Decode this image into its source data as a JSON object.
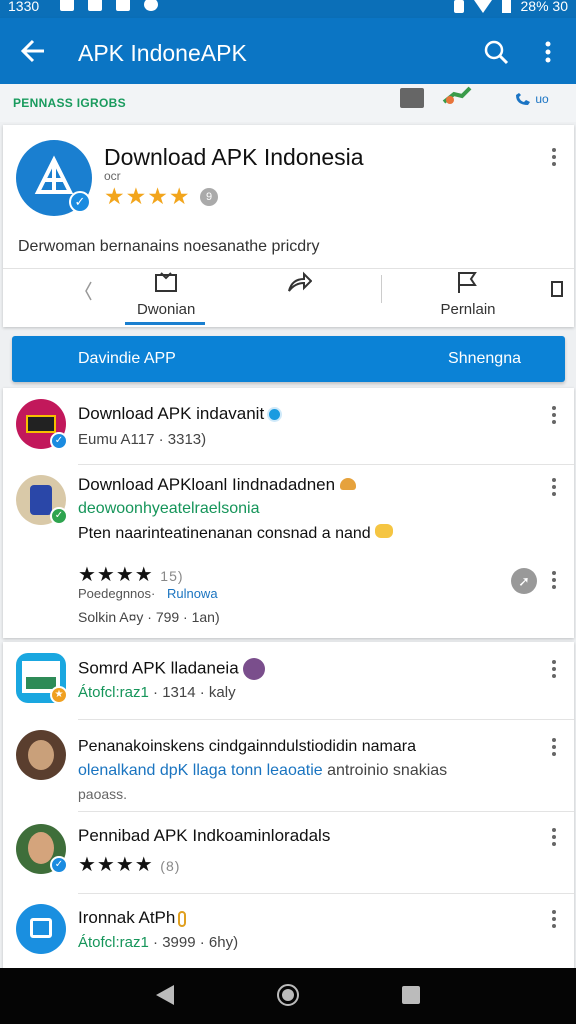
{
  "status_bar": {
    "time": "1330",
    "battery": "28% 30"
  },
  "app_bar": {
    "title": "APK IndoneAPK"
  },
  "sub_bar": {
    "label": "PENNASS IGROBS",
    "right_text": "uo"
  },
  "featured": {
    "name": "Download APK Indonesia",
    "sub": "ocr",
    "rating_stars": "★★★★",
    "rating_count": "9",
    "description": "Derwoman bernanains noesanathe pricdry",
    "actions": [
      {
        "label": "Dwonian"
      },
      {
        "label": ""
      },
      {
        "label": "Pernlain"
      }
    ]
  },
  "banner": {
    "left": "Davindie APP",
    "right": "Shnengna"
  },
  "list": [
    {
      "title": "Download APK indavanit",
      "meta": "Eumu A117 · 3313)"
    },
    {
      "title": "Download APKloanl Iindnadadnen",
      "line2": "deowoonhyeatelraelsonia",
      "line3": "Pten naarinteatinenanan consnad a nand",
      "stars": "★★★★",
      "count": "15)",
      "tag1": "Poedegnnos·",
      "tag2": "Rulnowa",
      "meta": "Solkin A¤y · 799 · 1an)"
    },
    {
      "title": "Somrd APK lladaneia",
      "meta_green": "Átofcl:raz1",
      "meta": "· 1314 · kaly"
    },
    {
      "title": "Penanakoinskens cindgainndulstiodidin namara",
      "line2_blue": "olenalkand dpK llaga tonn leaoatie",
      "line2_rest": "antroinio snakias",
      "line3": "paoass."
    },
    {
      "title": "Pennibad APK Indkoaminloradals",
      "stars": "★★★★",
      "count": "(8)"
    },
    {
      "title": "Ironnak AtPh",
      "meta_green": "Átofcl:raz1",
      "meta": "· 3999 · 6hy)"
    }
  ],
  "colors": {
    "primary": "#0b75c4",
    "accent_green": "#16955a",
    "star": "#f2a51c"
  }
}
